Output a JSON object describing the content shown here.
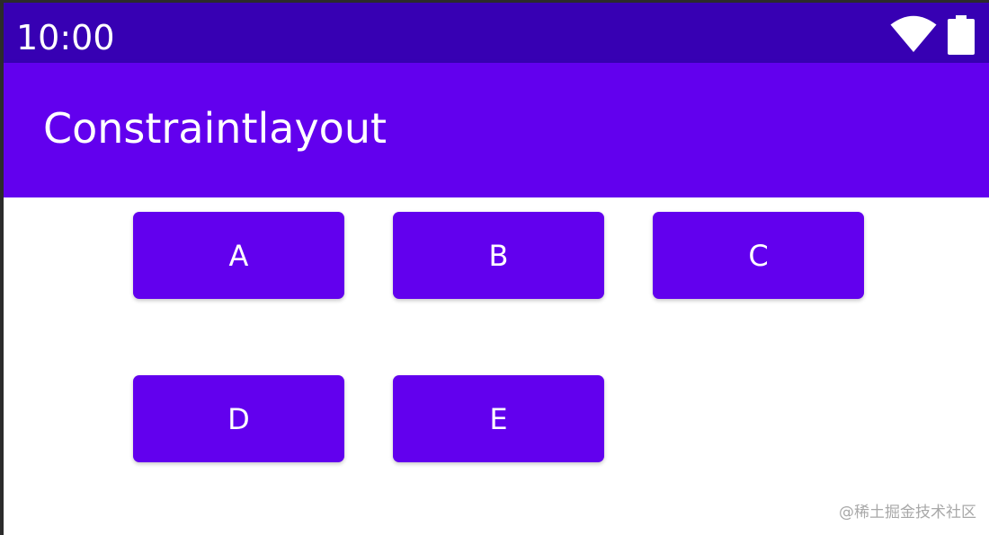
{
  "status_bar": {
    "time": "10:00",
    "icons": [
      "wifi-icon",
      "battery-icon"
    ],
    "color": "#3700b3"
  },
  "app_bar": {
    "title": "Constraintlayout",
    "color": "#6200ee"
  },
  "buttons": [
    {
      "label": "A"
    },
    {
      "label": "B"
    },
    {
      "label": "C"
    },
    {
      "label": "D"
    },
    {
      "label": "E"
    }
  ],
  "colors": {
    "primary": "#6200ee",
    "primary_dark": "#3700b3",
    "on_primary": "#ffffff",
    "background": "#ffffff"
  },
  "watermark": "@稀土掘金技术社区"
}
